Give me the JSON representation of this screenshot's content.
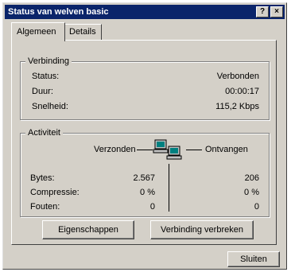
{
  "window": {
    "title": "Status van welven basic",
    "help_btn": "?",
    "close_btn": "×"
  },
  "tabs": [
    {
      "label": "Algemeen"
    },
    {
      "label": "Details"
    }
  ],
  "connection": {
    "legend": "Verbinding",
    "rows": [
      {
        "label": "Status:",
        "value": "Verbonden"
      },
      {
        "label": "Duur:",
        "value": "00:00:17"
      },
      {
        "label": "Snelheid:",
        "value": "115,2 Kbps"
      }
    ]
  },
  "activity": {
    "legend": "Activiteit",
    "sent_label": "Verzonden",
    "received_label": "Ontvangen",
    "rows": [
      {
        "label": "Bytes:",
        "sent": "2.567",
        "received": "206"
      },
      {
        "label": "Compressie:",
        "sent": "0 %",
        "received": "0 %"
      },
      {
        "label": "Fouten:",
        "sent": "0",
        "received": "0"
      }
    ]
  },
  "buttons": {
    "properties": "Eigenschappen",
    "disconnect": "Verbinding verbreken",
    "close": "Sluiten"
  }
}
